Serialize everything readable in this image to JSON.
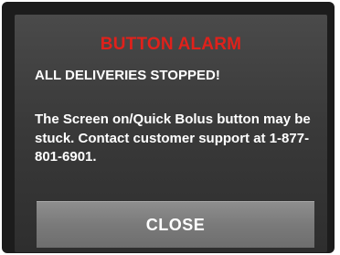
{
  "alarm": {
    "title": "BUTTON ALARM",
    "headline": "ALL DELIVERIES STOPPED!",
    "message": "The Screen on/Quick Bolus button may be stuck. Contact customer support at 1-877-801-6901.",
    "close_label": "CLOSE"
  },
  "colors": {
    "title": "#e0211b",
    "text": "#ffffff",
    "screen_background": "#3a3a3a",
    "button_background": "#7a7a7a"
  }
}
